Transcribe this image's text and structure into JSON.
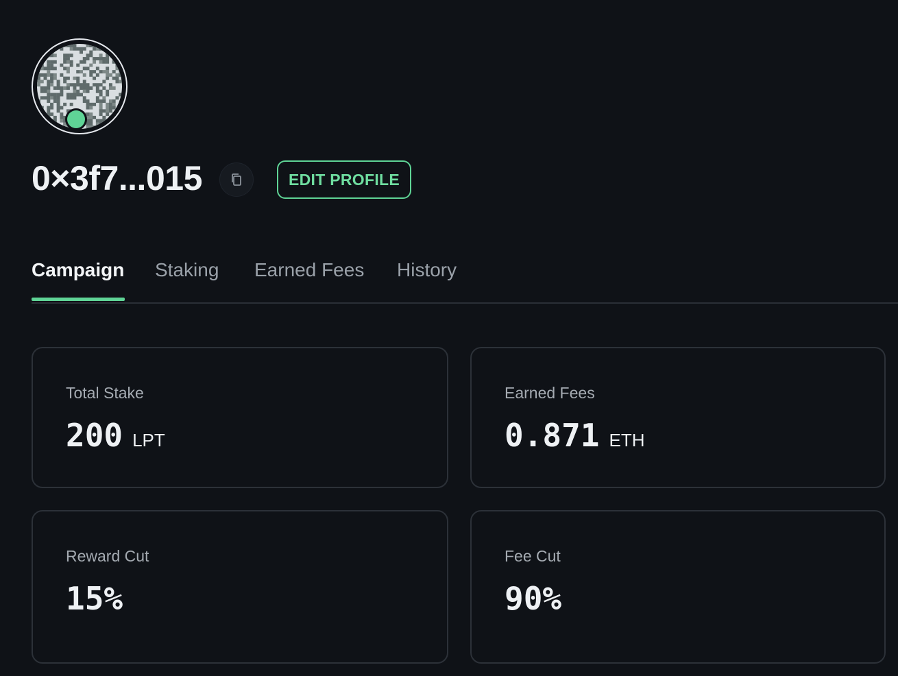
{
  "profile": {
    "address": "0×3f7...015",
    "status": "online",
    "edit_label": "EDIT PROFILE",
    "copy_icon": "copy-icon",
    "accent_color": "#5fd496"
  },
  "tabs": [
    {
      "label": "Campaign",
      "active": true
    },
    {
      "label": "Staking",
      "active": false
    },
    {
      "label": "Earned Fees",
      "active": false
    },
    {
      "label": "History",
      "active": false
    }
  ],
  "stats": {
    "total_stake": {
      "label": "Total Stake",
      "value": "200",
      "unit": "LPT"
    },
    "earned_fees": {
      "label": "Earned Fees",
      "value": "0.871",
      "unit": "ETH"
    },
    "reward_cut": {
      "label": "Reward Cut",
      "value": "15%"
    },
    "fee_cut": {
      "label": "Fee Cut",
      "value": "90%"
    }
  }
}
